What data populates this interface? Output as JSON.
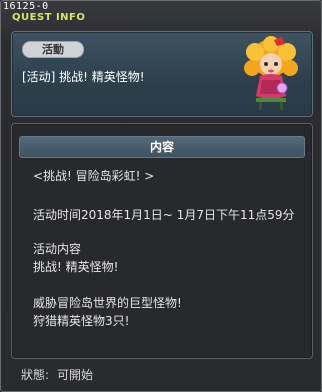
{
  "window": {
    "quest_id": "16125-0",
    "title": "QUEST INFO"
  },
  "summary": {
    "badge": "活動",
    "text": "[活动] 挑战! 精英怪物!"
  },
  "content": {
    "header": "内容",
    "lines": [
      "<挑战! 冒险岛彩虹! >",
      "活动时间2018年1月1日~ 1月7日下午11点59分",
      "活动内容",
      "挑战! 精英怪物!",
      "威胁冒险岛世界的巨型怪物!",
      "狩猎精英怪物3只!"
    ]
  },
  "status": {
    "label": "狀態:",
    "value": "可開始"
  },
  "colors": {
    "title": "#d9e36a",
    "panel": "#3f5362",
    "header": "#556a78"
  }
}
